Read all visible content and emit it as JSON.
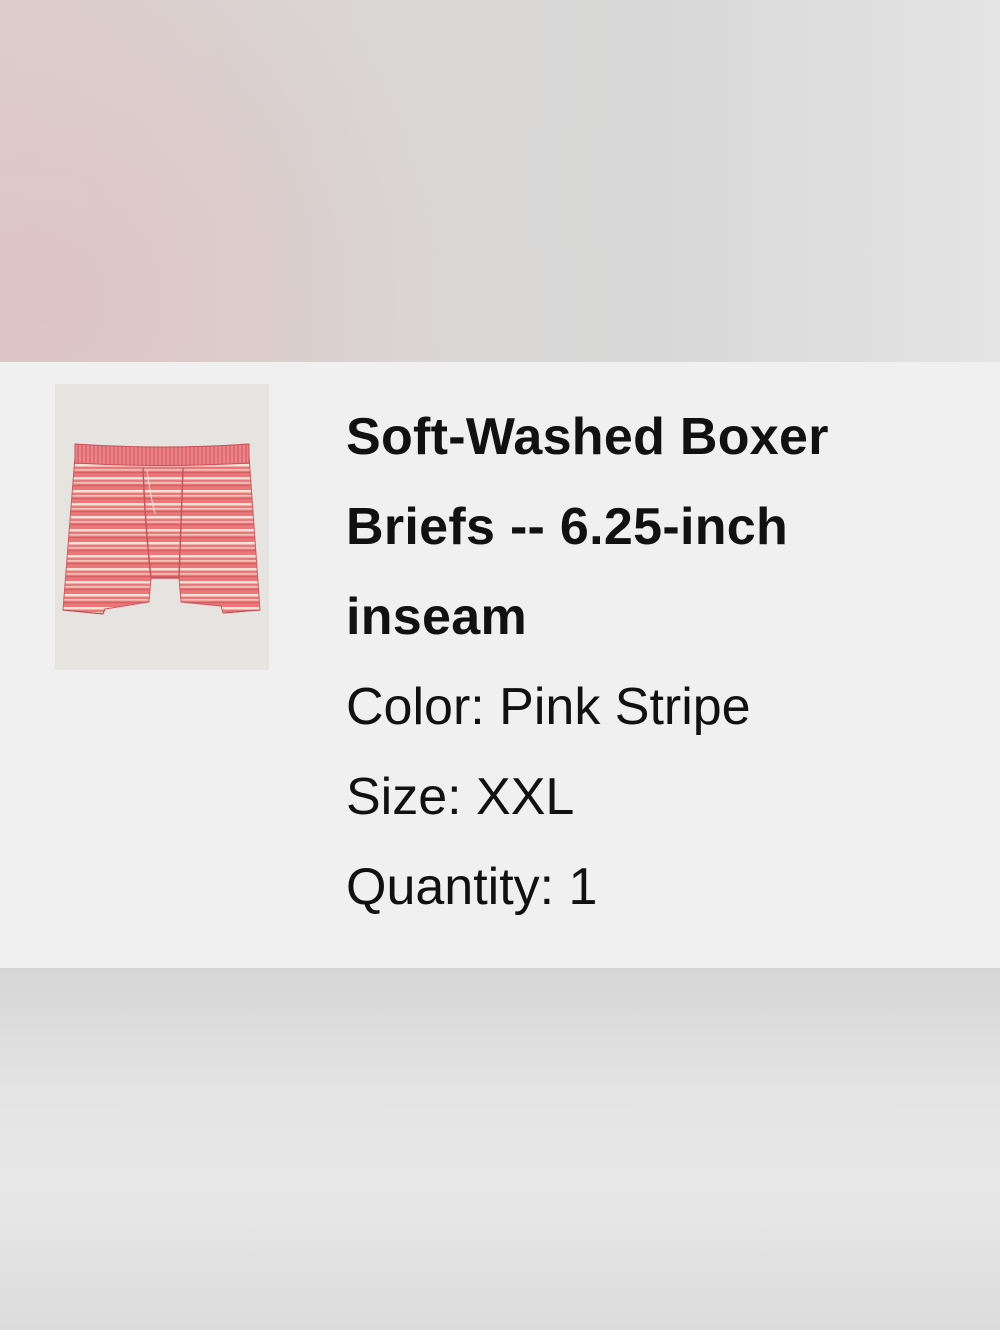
{
  "product": {
    "image_icon": "boxer-briefs-product-image",
    "title": "Soft-Washed Boxer Briefs -- 6.25-inch inseam",
    "color_line": "Color: Pink Stripe",
    "size_line": "Size: XXL",
    "quantity_line": "Quantity: 1"
  },
  "colors": {
    "card_bg": "#f0f0f0",
    "text": "#111111",
    "stripe_pink": "#e36b6f",
    "stripe_light": "#f6d8cf"
  }
}
